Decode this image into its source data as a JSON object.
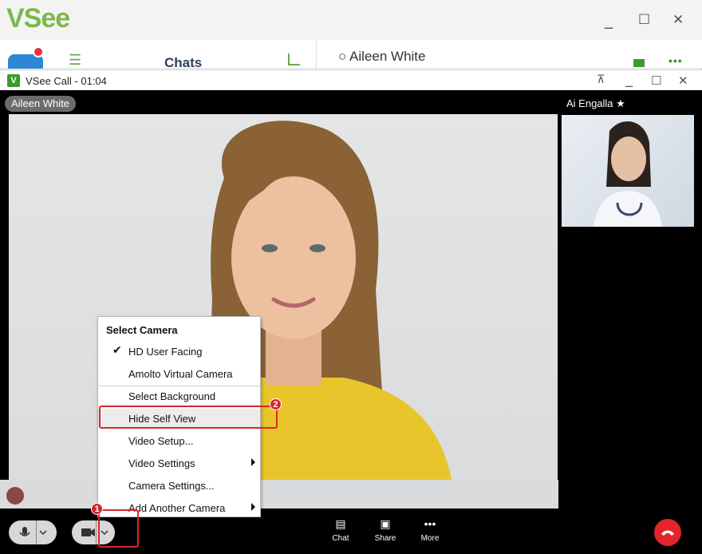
{
  "main_window": {
    "logo": "VSee",
    "minimize": "_",
    "maximize": "☐",
    "close": "✕",
    "chats_label": "Chats",
    "contact": "○ Aileen White",
    "more_dots": "•••"
  },
  "call_window": {
    "title": "VSee Call - 01:04",
    "pin": "⊼",
    "minimize": "_",
    "maximize": "☐",
    "close": "✕",
    "remote_name": "Aileen White",
    "self_name": "Ai Engalla ★"
  },
  "camera_menu": {
    "title": "Select Camera",
    "items": [
      {
        "label": "HD User Facing",
        "checked": true
      },
      {
        "label": "Amolto Virtual Camera"
      },
      {
        "label": "Select Background"
      },
      {
        "label": "Hide Self View",
        "highlighted": true
      },
      {
        "label": "Video Setup..."
      },
      {
        "label": "Video Settings",
        "submenu": true
      },
      {
        "label": "Camera Settings..."
      },
      {
        "label": "Add Another Camera",
        "submenu": true
      }
    ]
  },
  "toolbar": {
    "chat": "Chat",
    "share": "Share",
    "more": "More",
    "more_glyph": "•••"
  },
  "callouts": {
    "one": "1",
    "two": "2"
  },
  "colors": {
    "brand_green": "#7bb84a",
    "callout_red": "#d9262b",
    "hangup_red": "#e0262a"
  }
}
